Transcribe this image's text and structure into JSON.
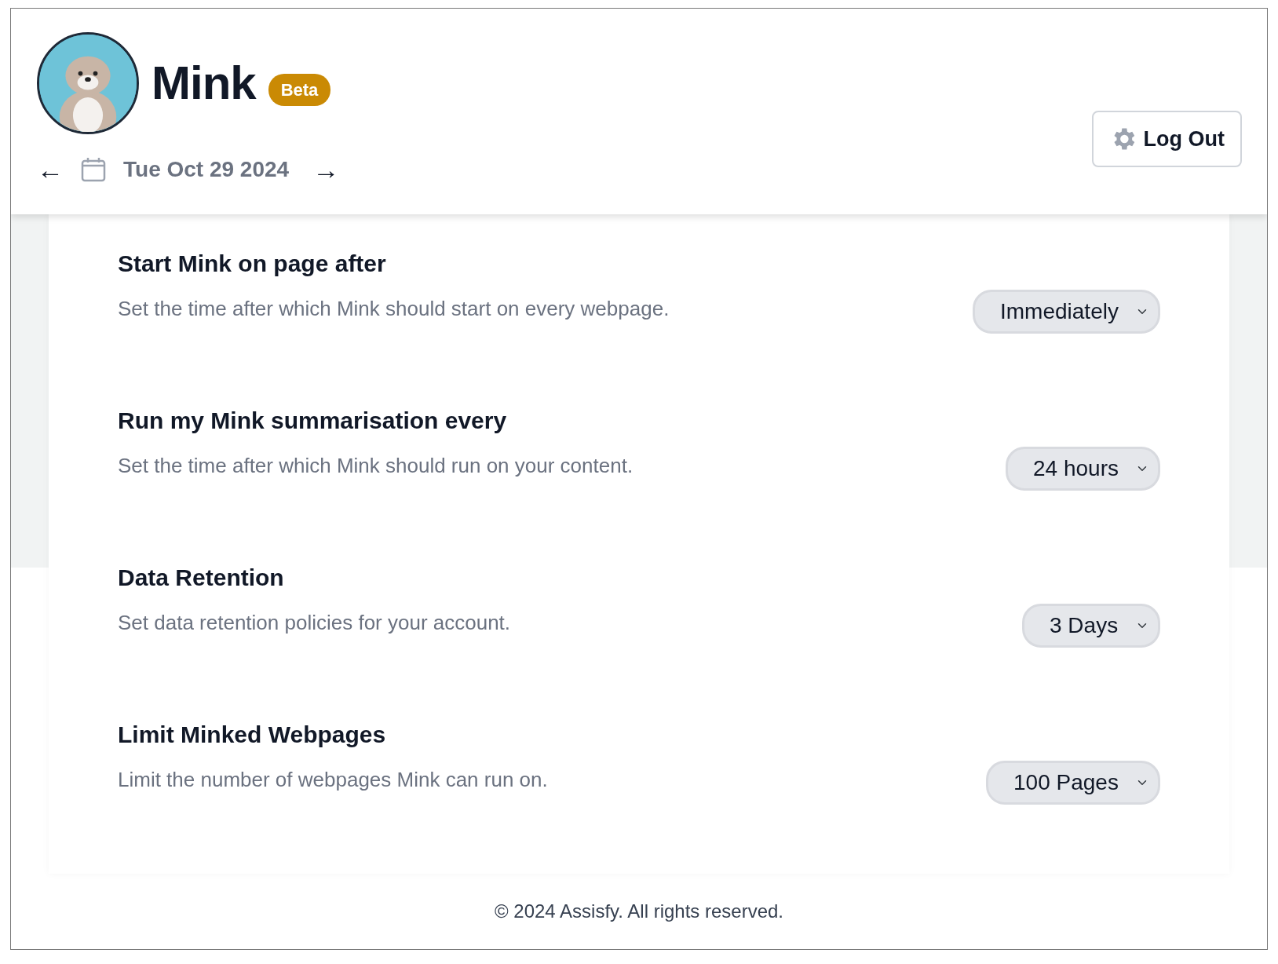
{
  "header": {
    "app_name": "Mink",
    "badge": "Beta",
    "date": "Tue Oct 29 2024",
    "prev_arrow": "←",
    "next_arrow": "→",
    "logout_button": "Log Out"
  },
  "settings": [
    {
      "title": "Start Mink on page after",
      "description": "Set the time after which Mink should start on every webpage.",
      "value": "Immediately"
    },
    {
      "title": "Run my Mink summarisation every",
      "description": "Set the time after which Mink should run on your content.",
      "value": "24 hours"
    },
    {
      "title": "Data Retention",
      "description": "Set data retention policies for your account.",
      "value": "3 Days"
    },
    {
      "title": "Limit Minked Webpages",
      "description": "Limit the number of webpages Mink can run on.",
      "value": "100 Pages"
    }
  ],
  "footer": "© 2024 Assisfy. All rights reserved."
}
